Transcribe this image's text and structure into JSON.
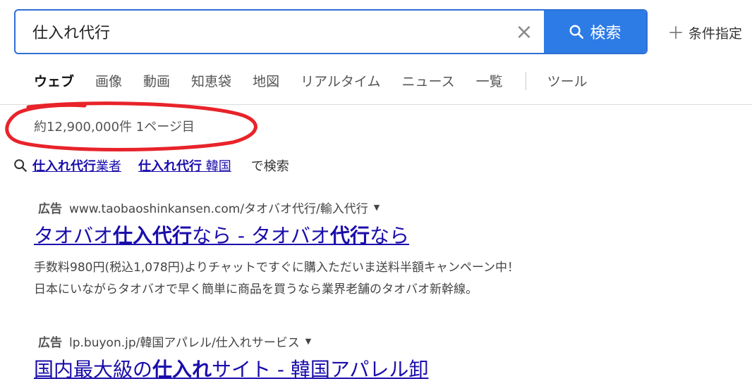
{
  "search": {
    "query": "仕入れ代行",
    "clear_icon": "×",
    "button_label": "検索"
  },
  "conditions": {
    "plus": "＋",
    "label": "条件指定"
  },
  "tabs": [
    {
      "label": "ウェブ",
      "active": true
    },
    {
      "label": "画像"
    },
    {
      "label": "動画"
    },
    {
      "label": "知恵袋"
    },
    {
      "label": "地図"
    },
    {
      "label": "リアルタイム"
    },
    {
      "label": "ニュース"
    },
    {
      "label": "一覧"
    },
    {
      "label": "ツール"
    }
  ],
  "result_count": "約12,900,000件 1ページ目",
  "annotation_color": "#e8232a",
  "related": {
    "items": [
      {
        "bold": "仕入れ代行",
        "rest": "業者"
      },
      {
        "bold": "仕入れ代行",
        "rest": " 韓国"
      }
    ],
    "suffix": "で検索"
  },
  "ads": [
    {
      "badge": "広告",
      "url": "www.taobaoshinkansen.com/タオバオ代行/輸入代行",
      "caret": "▼",
      "title_parts": [
        {
          "text": "タオバオ"
        },
        {
          "text": "仕入代行",
          "bold": true
        },
        {
          "text": "なら - タオバオ"
        },
        {
          "text": "代行",
          "bold": true
        },
        {
          "text": "なら"
        }
      ],
      "desc_lines": [
        "手数料980円(税込1,078円)よりチャットですぐに購入ただいま送料半額キャンペーン中！",
        "日本にいながらタオバオで早く簡単に商品を買うなら業界老舗のタオバオ新幹線。"
      ]
    },
    {
      "badge": "広告",
      "url": "lp.buyon.jp/韓国アパレル/仕入れサービス",
      "caret": "▼",
      "title_parts": [
        {
          "text": "国内最大級の"
        },
        {
          "text": "仕入れ",
          "bold": true
        },
        {
          "text": "サイト - 韓国アパレル卸"
        }
      ],
      "desc_lines": []
    }
  ]
}
